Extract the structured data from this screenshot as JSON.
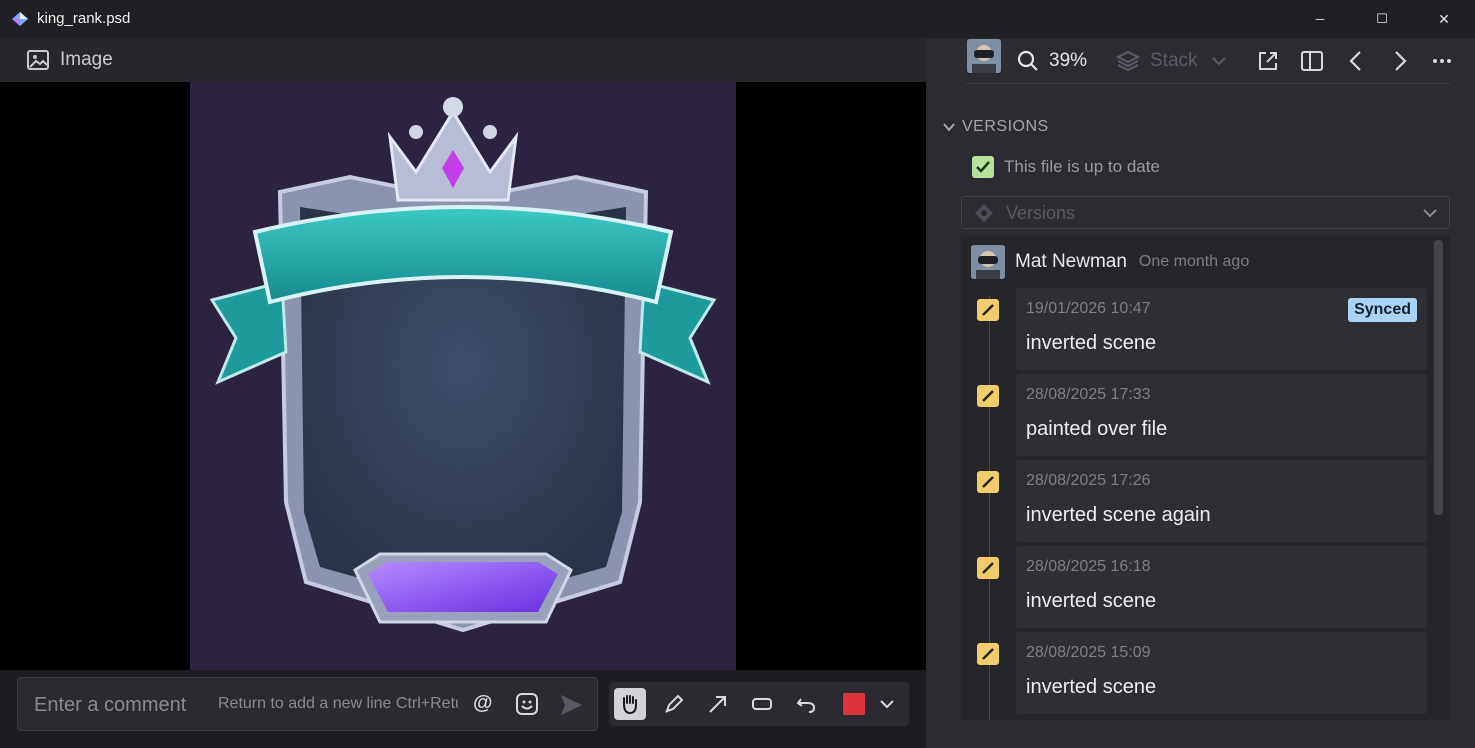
{
  "window": {
    "title": "king_rank.psd",
    "minimize_glyph": "─",
    "maximize_glyph": "☐",
    "close_glyph": "✕"
  },
  "viewer": {
    "header_label": "Image",
    "icons": {
      "header": "image-icon"
    }
  },
  "comment": {
    "placeholder": "Enter a comment",
    "hint": "Return to add a new line   Ctrl+Return to send",
    "at_symbol": "@"
  },
  "toolbar": {
    "zoom": "39%",
    "stack_label": "Stack"
  },
  "versions": {
    "section_title": "VERSIONS",
    "status": "This file is up to date",
    "select_placeholder": "Versions",
    "author": "Mat Newman",
    "author_time": "One month ago",
    "entries": [
      {
        "date": "19/01/2026 10:47",
        "message": "inverted scene",
        "badge": "Synced"
      },
      {
        "date": "28/08/2025 17:33",
        "message": "painted over file"
      },
      {
        "date": "28/08/2025 17:26",
        "message": "inverted scene again"
      },
      {
        "date": "28/08/2025 16:18",
        "message": "inverted scene"
      },
      {
        "date": "28/08/2025 15:09",
        "message": "inverted scene"
      }
    ]
  },
  "colors": {
    "accent_badge": "#a9d3f5",
    "pencil": "#f0cd6a",
    "check": "#b8e29a",
    "draw_color": "#e0323a"
  }
}
